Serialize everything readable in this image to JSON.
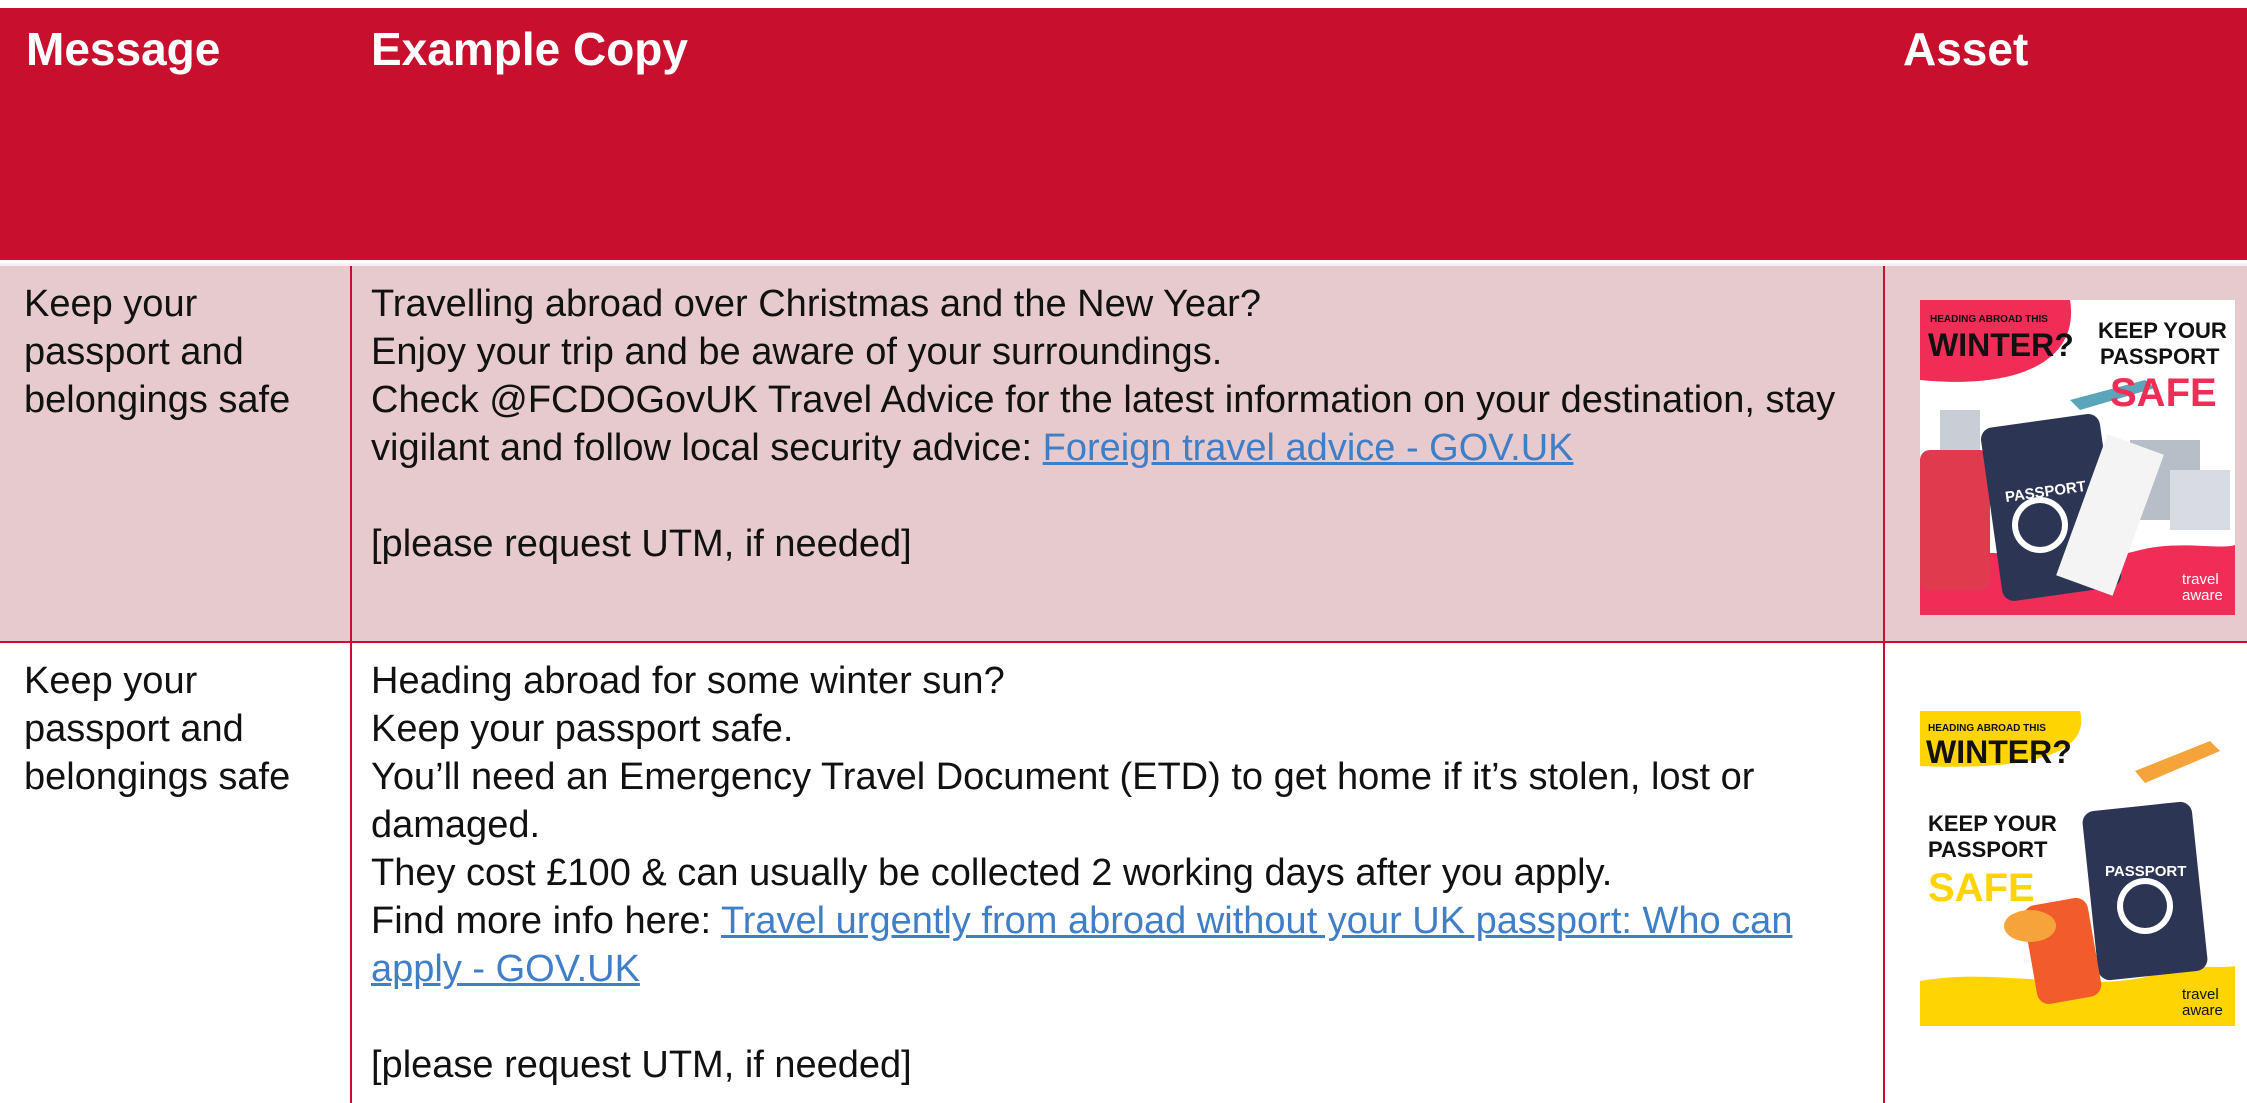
{
  "header": {
    "message": "Message",
    "example_copy": "Example Copy",
    "asset": "Asset"
  },
  "rows": [
    {
      "message": "Keep your passport and belongings safe",
      "lines": [
        "Travelling abroad over Christmas and the New Year?",
        "Enjoy your trip and be aware of your surroundings.",
        "Check @FCDOGovUK Travel Advice for the latest information on your destination, stay vigilant and follow local security advice: "
      ],
      "link": "Foreign travel advice - GOV.UK",
      "utm": "[please request UTM, if needed]",
      "asset": {
        "top_text": "HEADING ABROAD THIS",
        "winter": "WINTER?",
        "keep": "KEEP YOUR",
        "passport": "PASSPORT",
        "safe": "SAFE",
        "doc_label": "PASSPORT",
        "brand1": "travel",
        "brand2": "aware"
      }
    },
    {
      "message": "Keep your passport and belongings safe",
      "lines": [
        "Heading abroad for some winter sun?",
        "Keep your passport safe.",
        "You’ll need an Emergency Travel Document (ETD) to get home if it’s stolen, lost or damaged.",
        "They cost £100 & can usually be collected 2 working days after you apply.",
        "Find more info here: "
      ],
      "link": "Travel urgently from abroad without your UK passport: Who can apply - GOV.UK",
      "utm": "[please request UTM, if needed]",
      "asset": {
        "top_text": "HEADING ABROAD THIS",
        "winter": "WINTER?",
        "keep": "KEEP YOUR",
        "passport": "PASSPORT",
        "safe": "SAFE",
        "doc_label": "PASSPORT",
        "brand1": "travel",
        "brand2": "aware"
      }
    }
  ],
  "colors": {
    "header_bg": "#c8102e",
    "row1_bg": "#e7cacd",
    "link": "#3f7fc7"
  }
}
